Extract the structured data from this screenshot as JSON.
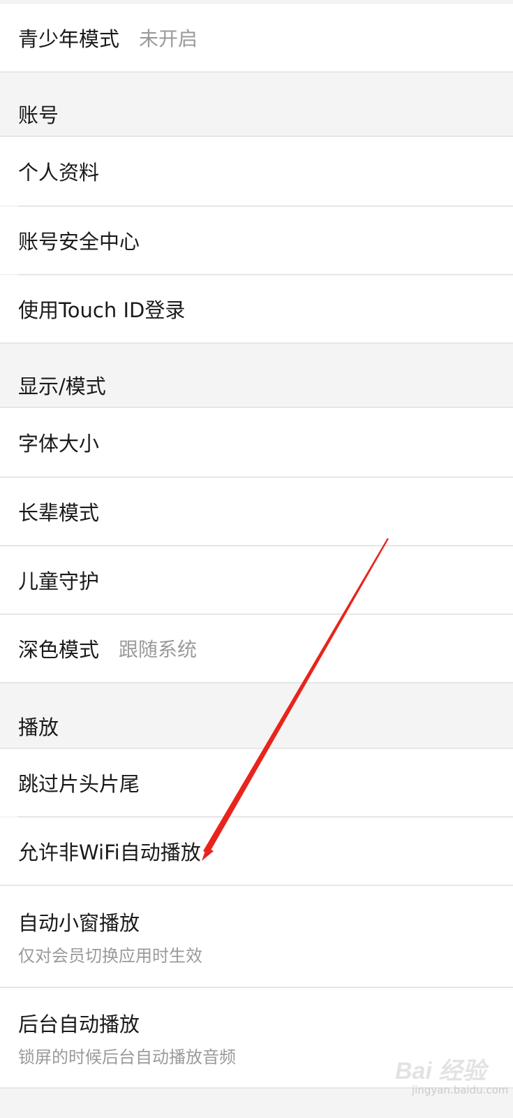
{
  "rows": {
    "teen_mode": {
      "label": "青少年模式",
      "value": "未开启"
    },
    "account_header": "账号",
    "profile": {
      "label": "个人资料"
    },
    "account_security": {
      "label": "账号安全中心"
    },
    "touch_id": {
      "label": "使用Touch ID登录"
    },
    "display_header": "显示/模式",
    "font_size": {
      "label": "字体大小"
    },
    "elder_mode": {
      "label": "长辈模式"
    },
    "child_guard": {
      "label": "儿童守护"
    },
    "dark_mode": {
      "label": "深色模式",
      "value": "跟随系统"
    },
    "playback_header": "播放",
    "skip_intro": {
      "label": "跳过片头片尾"
    },
    "non_wifi_autoplay": {
      "label": "允许非WiFi自动播放"
    },
    "pip_autoplay": {
      "label": "自动小窗播放",
      "sub": "仅对会员切换应用时生效"
    },
    "background_autoplay": {
      "label": "后台自动播放",
      "sub": "锁屏的时候后台自动播放音频"
    }
  },
  "watermark": {
    "brand": "Bai 经验",
    "url": "jingyan.baidu.com"
  },
  "colors": {
    "annotation_arrow": "#e8241c",
    "secondary_text": "#9a9a9a",
    "section_bg": "#f4f4f4"
  }
}
